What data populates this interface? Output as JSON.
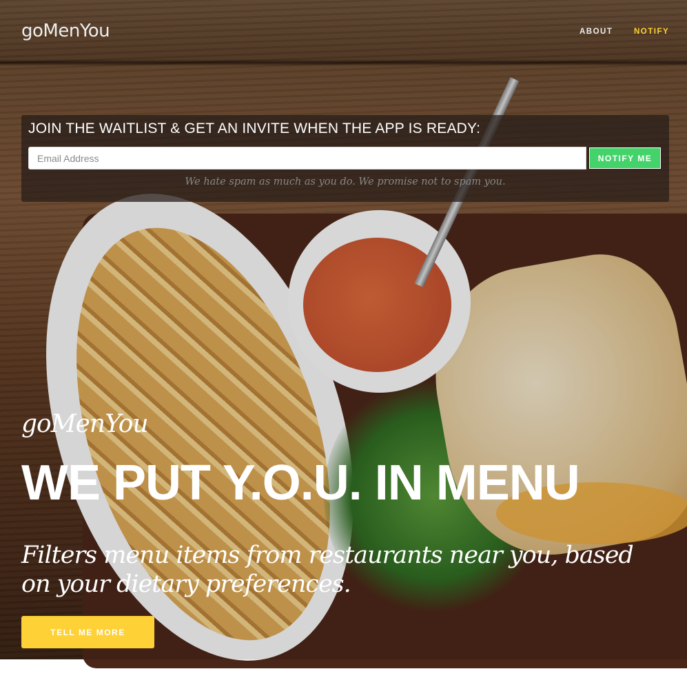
{
  "nav": {
    "brand": "goMenYou",
    "links": [
      {
        "label": "ABOUT",
        "color": "#eeeeee"
      },
      {
        "label": "NOTIFY",
        "color": "#fed136"
      }
    ]
  },
  "waitlist": {
    "title": "JOIN THE WAITLIST & GET AN INVITE WHEN THE APP IS READY:",
    "email_placeholder": "Email Address",
    "email_value": "",
    "button_label": "NOTIFY ME",
    "note": "We hate spam as much as you do. We promise not to spam you."
  },
  "hero": {
    "brand": "goMenYou",
    "title": "WE PUT Y.O.U. IN MENU",
    "subtitle": "Filters menu items from restaurants near you, based on your dietary preferences.",
    "cta_label": "TELL ME MORE"
  },
  "colors": {
    "accent": "#fed136",
    "notify_button": "#44d36a"
  }
}
